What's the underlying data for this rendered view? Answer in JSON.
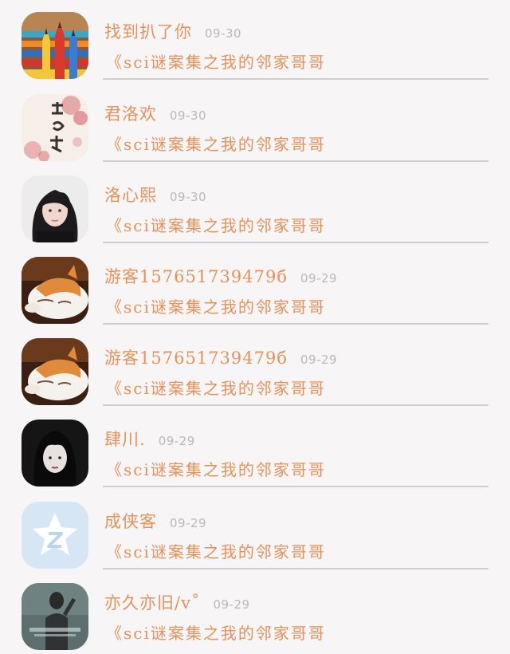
{
  "comments": [
    {
      "username": "找到扒了你",
      "date": "09-30",
      "book": "《sci谜案集之我的邻家哥哥",
      "avatar": "pencils-avatar"
    },
    {
      "username": "君洛欢",
      "date": "09-30",
      "book": "《sci谜案集之我的邻家哥哥",
      "avatar": "calligraphy-avatar"
    },
    {
      "username": "洛心熙",
      "date": "09-30",
      "book": "《sci谜案集之我的邻家哥哥",
      "avatar": "woman-portrait-avatar"
    },
    {
      "username": "游客157651739479б",
      "date": "09-29",
      "book": "《sci谜案集之我的邻家哥哥",
      "avatar": "sleeping-cat-avatar"
    },
    {
      "username": "游客157651739479б",
      "date": "09-29",
      "book": "《sci谜案集之我的邻家哥哥",
      "avatar": "sleeping-cat-avatar"
    },
    {
      "username": "肆川.",
      "date": "09-29",
      "book": "《sci谜案集之我的邻家哥哥",
      "avatar": "dark-hair-portrait-avatar"
    },
    {
      "username": "成侠客",
      "date": "09-29",
      "book": "《sci谜案集之我的邻家哥哥",
      "avatar": "qq-default-avatar"
    },
    {
      "username": "亦久亦旧/v˚",
      "date": "09-29",
      "book": "《sci谜案集之我的邻家哥哥",
      "avatar": "boy-graffiti-avatar"
    }
  ]
}
